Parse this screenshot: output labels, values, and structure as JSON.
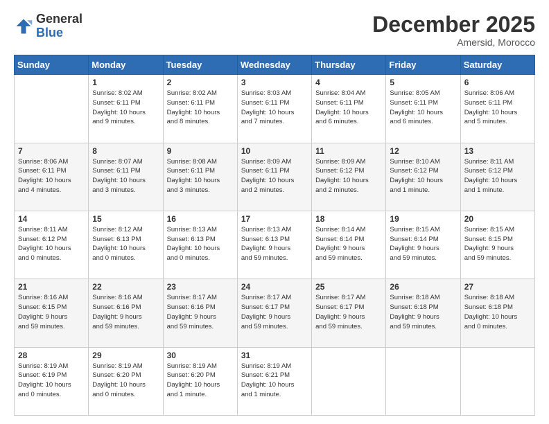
{
  "header": {
    "logo_general": "General",
    "logo_blue": "Blue",
    "month": "December 2025",
    "location": "Amersid, Morocco"
  },
  "days_of_week": [
    "Sunday",
    "Monday",
    "Tuesday",
    "Wednesday",
    "Thursday",
    "Friday",
    "Saturday"
  ],
  "weeks": [
    [
      {
        "day": "",
        "info": ""
      },
      {
        "day": "1",
        "info": "Sunrise: 8:02 AM\nSunset: 6:11 PM\nDaylight: 10 hours\nand 9 minutes."
      },
      {
        "day": "2",
        "info": "Sunrise: 8:02 AM\nSunset: 6:11 PM\nDaylight: 10 hours\nand 8 minutes."
      },
      {
        "day": "3",
        "info": "Sunrise: 8:03 AM\nSunset: 6:11 PM\nDaylight: 10 hours\nand 7 minutes."
      },
      {
        "day": "4",
        "info": "Sunrise: 8:04 AM\nSunset: 6:11 PM\nDaylight: 10 hours\nand 6 minutes."
      },
      {
        "day": "5",
        "info": "Sunrise: 8:05 AM\nSunset: 6:11 PM\nDaylight: 10 hours\nand 6 minutes."
      },
      {
        "day": "6",
        "info": "Sunrise: 8:06 AM\nSunset: 6:11 PM\nDaylight: 10 hours\nand 5 minutes."
      }
    ],
    [
      {
        "day": "7",
        "info": "Sunrise: 8:06 AM\nSunset: 6:11 PM\nDaylight: 10 hours\nand 4 minutes."
      },
      {
        "day": "8",
        "info": "Sunrise: 8:07 AM\nSunset: 6:11 PM\nDaylight: 10 hours\nand 3 minutes."
      },
      {
        "day": "9",
        "info": "Sunrise: 8:08 AM\nSunset: 6:11 PM\nDaylight: 10 hours\nand 3 minutes."
      },
      {
        "day": "10",
        "info": "Sunrise: 8:09 AM\nSunset: 6:11 PM\nDaylight: 10 hours\nand 2 minutes."
      },
      {
        "day": "11",
        "info": "Sunrise: 8:09 AM\nSunset: 6:12 PM\nDaylight: 10 hours\nand 2 minutes."
      },
      {
        "day": "12",
        "info": "Sunrise: 8:10 AM\nSunset: 6:12 PM\nDaylight: 10 hours\nand 1 minute."
      },
      {
        "day": "13",
        "info": "Sunrise: 8:11 AM\nSunset: 6:12 PM\nDaylight: 10 hours\nand 1 minute."
      }
    ],
    [
      {
        "day": "14",
        "info": "Sunrise: 8:11 AM\nSunset: 6:12 PM\nDaylight: 10 hours\nand 0 minutes."
      },
      {
        "day": "15",
        "info": "Sunrise: 8:12 AM\nSunset: 6:13 PM\nDaylight: 10 hours\nand 0 minutes."
      },
      {
        "day": "16",
        "info": "Sunrise: 8:13 AM\nSunset: 6:13 PM\nDaylight: 10 hours\nand 0 minutes."
      },
      {
        "day": "17",
        "info": "Sunrise: 8:13 AM\nSunset: 6:13 PM\nDaylight: 9 hours\nand 59 minutes."
      },
      {
        "day": "18",
        "info": "Sunrise: 8:14 AM\nSunset: 6:14 PM\nDaylight: 9 hours\nand 59 minutes."
      },
      {
        "day": "19",
        "info": "Sunrise: 8:15 AM\nSunset: 6:14 PM\nDaylight: 9 hours\nand 59 minutes."
      },
      {
        "day": "20",
        "info": "Sunrise: 8:15 AM\nSunset: 6:15 PM\nDaylight: 9 hours\nand 59 minutes."
      }
    ],
    [
      {
        "day": "21",
        "info": "Sunrise: 8:16 AM\nSunset: 6:15 PM\nDaylight: 9 hours\nand 59 minutes."
      },
      {
        "day": "22",
        "info": "Sunrise: 8:16 AM\nSunset: 6:16 PM\nDaylight: 9 hours\nand 59 minutes."
      },
      {
        "day": "23",
        "info": "Sunrise: 8:17 AM\nSunset: 6:16 PM\nDaylight: 9 hours\nand 59 minutes."
      },
      {
        "day": "24",
        "info": "Sunrise: 8:17 AM\nSunset: 6:17 PM\nDaylight: 9 hours\nand 59 minutes."
      },
      {
        "day": "25",
        "info": "Sunrise: 8:17 AM\nSunset: 6:17 PM\nDaylight: 9 hours\nand 59 minutes."
      },
      {
        "day": "26",
        "info": "Sunrise: 8:18 AM\nSunset: 6:18 PM\nDaylight: 9 hours\nand 59 minutes."
      },
      {
        "day": "27",
        "info": "Sunrise: 8:18 AM\nSunset: 6:18 PM\nDaylight: 10 hours\nand 0 minutes."
      }
    ],
    [
      {
        "day": "28",
        "info": "Sunrise: 8:19 AM\nSunset: 6:19 PM\nDaylight: 10 hours\nand 0 minutes."
      },
      {
        "day": "29",
        "info": "Sunrise: 8:19 AM\nSunset: 6:20 PM\nDaylight: 10 hours\nand 0 minutes."
      },
      {
        "day": "30",
        "info": "Sunrise: 8:19 AM\nSunset: 6:20 PM\nDaylight: 10 hours\nand 1 minute."
      },
      {
        "day": "31",
        "info": "Sunrise: 8:19 AM\nSunset: 6:21 PM\nDaylight: 10 hours\nand 1 minute."
      },
      {
        "day": "",
        "info": ""
      },
      {
        "day": "",
        "info": ""
      },
      {
        "day": "",
        "info": ""
      }
    ]
  ]
}
